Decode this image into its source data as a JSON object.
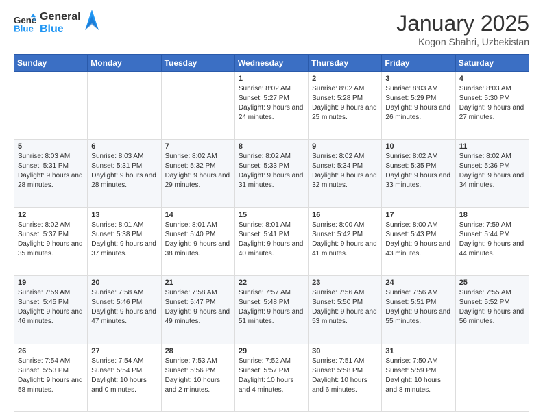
{
  "header": {
    "logo_line1": "General",
    "logo_line2": "Blue",
    "month_title": "January 2025",
    "location": "Kogon Shahri, Uzbekistan"
  },
  "days_of_week": [
    "Sunday",
    "Monday",
    "Tuesday",
    "Wednesday",
    "Thursday",
    "Friday",
    "Saturday"
  ],
  "weeks": [
    [
      {
        "day": "",
        "sunrise": "",
        "sunset": "",
        "daylight": ""
      },
      {
        "day": "",
        "sunrise": "",
        "sunset": "",
        "daylight": ""
      },
      {
        "day": "",
        "sunrise": "",
        "sunset": "",
        "daylight": ""
      },
      {
        "day": "1",
        "sunrise": "Sunrise: 8:02 AM",
        "sunset": "Sunset: 5:27 PM",
        "daylight": "Daylight: 9 hours and 24 minutes."
      },
      {
        "day": "2",
        "sunrise": "Sunrise: 8:02 AM",
        "sunset": "Sunset: 5:28 PM",
        "daylight": "Daylight: 9 hours and 25 minutes."
      },
      {
        "day": "3",
        "sunrise": "Sunrise: 8:03 AM",
        "sunset": "Sunset: 5:29 PM",
        "daylight": "Daylight: 9 hours and 26 minutes."
      },
      {
        "day": "4",
        "sunrise": "Sunrise: 8:03 AM",
        "sunset": "Sunset: 5:30 PM",
        "daylight": "Daylight: 9 hours and 27 minutes."
      }
    ],
    [
      {
        "day": "5",
        "sunrise": "Sunrise: 8:03 AM",
        "sunset": "Sunset: 5:31 PM",
        "daylight": "Daylight: 9 hours and 28 minutes."
      },
      {
        "day": "6",
        "sunrise": "Sunrise: 8:03 AM",
        "sunset": "Sunset: 5:31 PM",
        "daylight": "Daylight: 9 hours and 28 minutes."
      },
      {
        "day": "7",
        "sunrise": "Sunrise: 8:02 AM",
        "sunset": "Sunset: 5:32 PM",
        "daylight": "Daylight: 9 hours and 29 minutes."
      },
      {
        "day": "8",
        "sunrise": "Sunrise: 8:02 AM",
        "sunset": "Sunset: 5:33 PM",
        "daylight": "Daylight: 9 hours and 31 minutes."
      },
      {
        "day": "9",
        "sunrise": "Sunrise: 8:02 AM",
        "sunset": "Sunset: 5:34 PM",
        "daylight": "Daylight: 9 hours and 32 minutes."
      },
      {
        "day": "10",
        "sunrise": "Sunrise: 8:02 AM",
        "sunset": "Sunset: 5:35 PM",
        "daylight": "Daylight: 9 hours and 33 minutes."
      },
      {
        "day": "11",
        "sunrise": "Sunrise: 8:02 AM",
        "sunset": "Sunset: 5:36 PM",
        "daylight": "Daylight: 9 hours and 34 minutes."
      }
    ],
    [
      {
        "day": "12",
        "sunrise": "Sunrise: 8:02 AM",
        "sunset": "Sunset: 5:37 PM",
        "daylight": "Daylight: 9 hours and 35 minutes."
      },
      {
        "day": "13",
        "sunrise": "Sunrise: 8:01 AM",
        "sunset": "Sunset: 5:38 PM",
        "daylight": "Daylight: 9 hours and 37 minutes."
      },
      {
        "day": "14",
        "sunrise": "Sunrise: 8:01 AM",
        "sunset": "Sunset: 5:40 PM",
        "daylight": "Daylight: 9 hours and 38 minutes."
      },
      {
        "day": "15",
        "sunrise": "Sunrise: 8:01 AM",
        "sunset": "Sunset: 5:41 PM",
        "daylight": "Daylight: 9 hours and 40 minutes."
      },
      {
        "day": "16",
        "sunrise": "Sunrise: 8:00 AM",
        "sunset": "Sunset: 5:42 PM",
        "daylight": "Daylight: 9 hours and 41 minutes."
      },
      {
        "day": "17",
        "sunrise": "Sunrise: 8:00 AM",
        "sunset": "Sunset: 5:43 PM",
        "daylight": "Daylight: 9 hours and 43 minutes."
      },
      {
        "day": "18",
        "sunrise": "Sunrise: 7:59 AM",
        "sunset": "Sunset: 5:44 PM",
        "daylight": "Daylight: 9 hours and 44 minutes."
      }
    ],
    [
      {
        "day": "19",
        "sunrise": "Sunrise: 7:59 AM",
        "sunset": "Sunset: 5:45 PM",
        "daylight": "Daylight: 9 hours and 46 minutes."
      },
      {
        "day": "20",
        "sunrise": "Sunrise: 7:58 AM",
        "sunset": "Sunset: 5:46 PM",
        "daylight": "Daylight: 9 hours and 47 minutes."
      },
      {
        "day": "21",
        "sunrise": "Sunrise: 7:58 AM",
        "sunset": "Sunset: 5:47 PM",
        "daylight": "Daylight: 9 hours and 49 minutes."
      },
      {
        "day": "22",
        "sunrise": "Sunrise: 7:57 AM",
        "sunset": "Sunset: 5:48 PM",
        "daylight": "Daylight: 9 hours and 51 minutes."
      },
      {
        "day": "23",
        "sunrise": "Sunrise: 7:56 AM",
        "sunset": "Sunset: 5:50 PM",
        "daylight": "Daylight: 9 hours and 53 minutes."
      },
      {
        "day": "24",
        "sunrise": "Sunrise: 7:56 AM",
        "sunset": "Sunset: 5:51 PM",
        "daylight": "Daylight: 9 hours and 55 minutes."
      },
      {
        "day": "25",
        "sunrise": "Sunrise: 7:55 AM",
        "sunset": "Sunset: 5:52 PM",
        "daylight": "Daylight: 9 hours and 56 minutes."
      }
    ],
    [
      {
        "day": "26",
        "sunrise": "Sunrise: 7:54 AM",
        "sunset": "Sunset: 5:53 PM",
        "daylight": "Daylight: 9 hours and 58 minutes."
      },
      {
        "day": "27",
        "sunrise": "Sunrise: 7:54 AM",
        "sunset": "Sunset: 5:54 PM",
        "daylight": "Daylight: 10 hours and 0 minutes."
      },
      {
        "day": "28",
        "sunrise": "Sunrise: 7:53 AM",
        "sunset": "Sunset: 5:56 PM",
        "daylight": "Daylight: 10 hours and 2 minutes."
      },
      {
        "day": "29",
        "sunrise": "Sunrise: 7:52 AM",
        "sunset": "Sunset: 5:57 PM",
        "daylight": "Daylight: 10 hours and 4 minutes."
      },
      {
        "day": "30",
        "sunrise": "Sunrise: 7:51 AM",
        "sunset": "Sunset: 5:58 PM",
        "daylight": "Daylight: 10 hours and 6 minutes."
      },
      {
        "day": "31",
        "sunrise": "Sunrise: 7:50 AM",
        "sunset": "Sunset: 5:59 PM",
        "daylight": "Daylight: 10 hours and 8 minutes."
      },
      {
        "day": "",
        "sunrise": "",
        "sunset": "",
        "daylight": ""
      }
    ]
  ]
}
